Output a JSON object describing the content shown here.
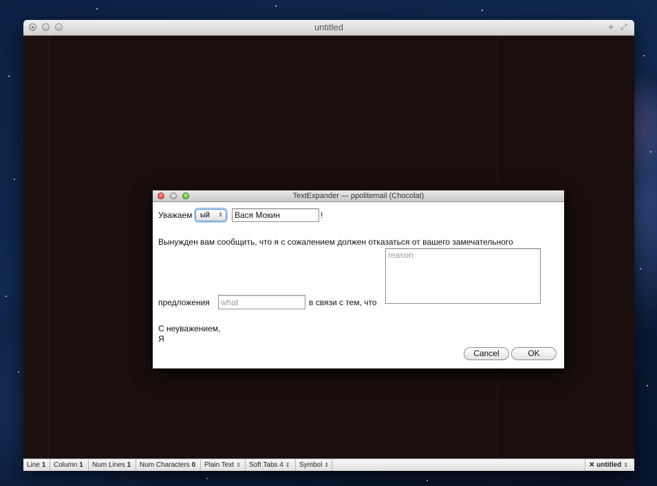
{
  "main_window": {
    "title": "untitled"
  },
  "status_bar": {
    "line_label": "Line",
    "line_value": "1",
    "column_label": "Column",
    "column_value": "1",
    "num_lines_label": "Num Lines",
    "num_lines_value": "1",
    "num_chars_label": "Num Characters",
    "num_chars_value": "0",
    "syntax_mode": "Plain Text",
    "soft_tabs": "Soft Tabs 4",
    "symbol": "Symbol",
    "document_name": "untitled"
  },
  "dialog": {
    "title": "TextExpander — ppolitemail (Chocolat)",
    "greeting_prefix": "Уважаем",
    "gender_popup_value": "ый",
    "name_value": "Вася Мокин",
    "exclamation": "!",
    "body_line": "Вынужден вам сообщить, что я с сожалением должен отказаться от вашего замечательного",
    "proposal_label": "предложения",
    "what_placeholder": "what",
    "because_label": "в связи с тем, что",
    "reason_placeholder": "reason",
    "signoff_line1": "С неуважением,",
    "signoff_line2": "Я",
    "cancel_label": "Cancel",
    "ok_label": "OK"
  }
}
